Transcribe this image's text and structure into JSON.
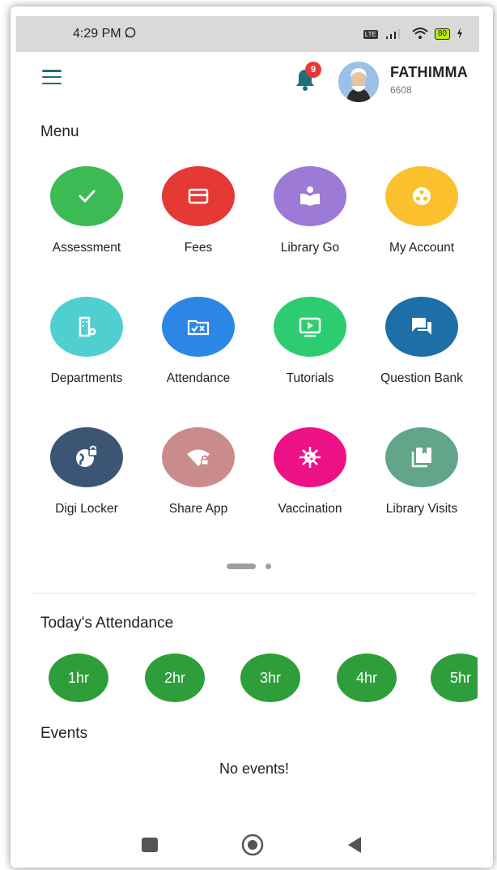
{
  "status_bar": {
    "time": "4:29 PM",
    "volte": "Vo LTE",
    "battery": "80"
  },
  "header": {
    "notification_count": "9",
    "user_name": "FATHIMMA",
    "user_id": "6608"
  },
  "menu": {
    "title": "Menu",
    "items": [
      {
        "label": "Assessment",
        "color": "#3cba54",
        "icon": "check-icon"
      },
      {
        "label": "Fees",
        "color": "#e53935",
        "icon": "card-icon"
      },
      {
        "label": "Library Go",
        "color": "#9c7ad6",
        "icon": "book-reader-icon"
      },
      {
        "label": "My Account",
        "color": "#fbc02d",
        "icon": "account-circle-icon"
      },
      {
        "label": "Departments",
        "color": "#4fcfcf",
        "icon": "building-gear-icon"
      },
      {
        "label": "Attendance",
        "color": "#2c86e6",
        "icon": "folder-check-icon"
      },
      {
        "label": "Tutorials",
        "color": "#2ecc71",
        "icon": "play-screen-icon"
      },
      {
        "label": "Question Bank",
        "color": "#1e6fa8",
        "icon": "chat-icon"
      },
      {
        "label": "Digi Locker",
        "color": "#3d5575",
        "icon": "globe-lock-icon"
      },
      {
        "label": "Share App",
        "color": "#c98c8a",
        "icon": "wifi-lock-icon"
      },
      {
        "label": "Vaccination",
        "color": "#ec1185",
        "icon": "virus-icon"
      },
      {
        "label": "Library Visits",
        "color": "#62a58b",
        "icon": "bookmark-stack-icon"
      }
    ]
  },
  "attendance": {
    "title": "Today's Attendance",
    "hours": [
      "1hr",
      "2hr",
      "3hr",
      "4hr",
      "5hr"
    ],
    "color": "#2e9e3b"
  },
  "events": {
    "title": "Events",
    "empty_text": "No events!"
  }
}
